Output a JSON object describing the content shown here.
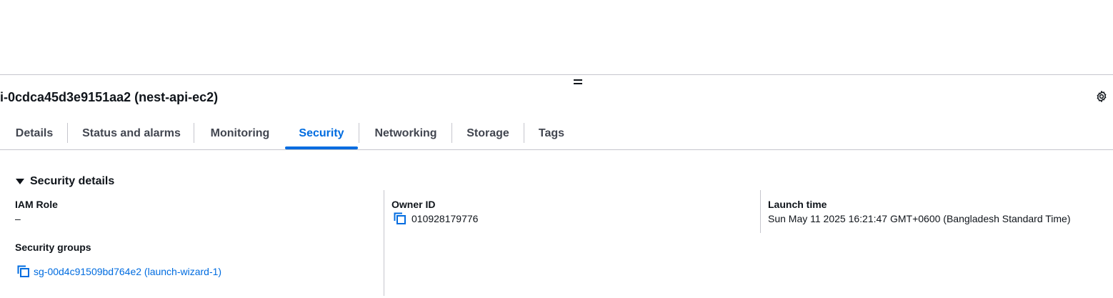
{
  "panel": {
    "title": "i-0cdca45d3e9151aa2 (nest-api-ec2)",
    "divider_icon": "drag-handle-icon",
    "settings_icon": "gear-icon"
  },
  "tabs": [
    {
      "label": "Details",
      "active": false
    },
    {
      "label": "Status and alarms",
      "active": false
    },
    {
      "label": "Monitoring",
      "active": false
    },
    {
      "label": "Security",
      "active": true
    },
    {
      "label": "Networking",
      "active": false
    },
    {
      "label": "Storage",
      "active": false
    },
    {
      "label": "Tags",
      "active": false
    }
  ],
  "security_details": {
    "title": "Security details",
    "expanded": true,
    "iam_role": {
      "label": "IAM Role",
      "value": "–"
    },
    "owner_id": {
      "label": "Owner ID",
      "value": "010928179776",
      "icon": "copy-icon"
    },
    "launch_time": {
      "label": "Launch time",
      "value": "Sun May 11 2025 16:21:47 GMT+0600 (Bangladesh Standard Time)"
    },
    "security_groups": {
      "label": "Security groups",
      "value": "sg-00d4c91509bd764e2 (launch-wizard-1)",
      "icon": "copy-icon"
    }
  },
  "colors": {
    "accent": "#006ce0",
    "text": "#0f141a",
    "tab_text": "#424650",
    "border": "#c6c6cd"
  }
}
